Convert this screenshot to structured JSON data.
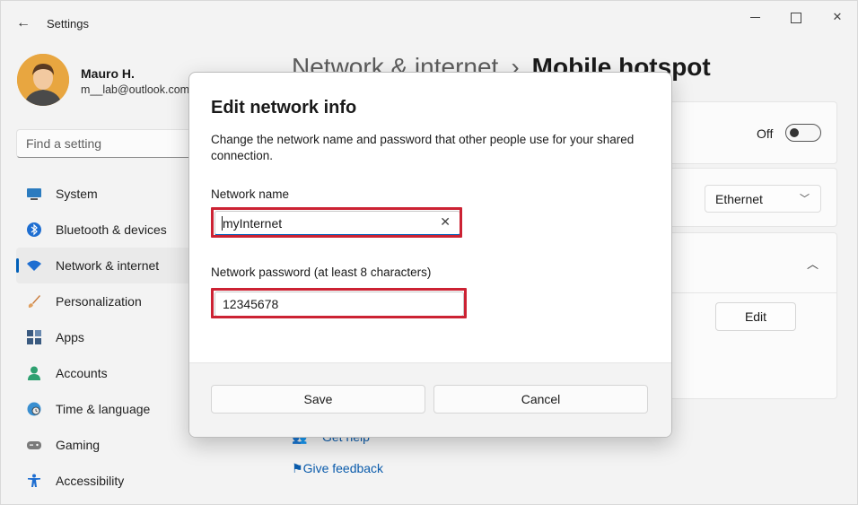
{
  "window": {
    "title": "Settings"
  },
  "user": {
    "name": "Mauro H.",
    "email": "m__lab@outlook.com"
  },
  "search": {
    "placeholder": "Find a setting"
  },
  "nav": {
    "items": [
      {
        "label": "System",
        "icon": "monitor-icon"
      },
      {
        "label": "Bluetooth & devices",
        "icon": "bluetooth-icon"
      },
      {
        "label": "Network & internet",
        "icon": "wifi-icon",
        "active": true
      },
      {
        "label": "Personalization",
        "icon": "brush-icon"
      },
      {
        "label": "Apps",
        "icon": "apps-icon"
      },
      {
        "label": "Accounts",
        "icon": "person-icon"
      },
      {
        "label": "Time & language",
        "icon": "globe-clock-icon"
      },
      {
        "label": "Gaming",
        "icon": "gamepad-icon"
      },
      {
        "label": "Accessibility",
        "icon": "accessibility-icon"
      }
    ]
  },
  "content": {
    "breadcrumb_parent": "Network & internet",
    "breadcrumb_separator": "›",
    "breadcrumb_current": "Mobile hotspot",
    "hotspot_toggle_label": "Off",
    "share_from_value": "Ethernet",
    "edit_button": "Edit",
    "get_help": "Get help",
    "give_feedback": "Give feedback"
  },
  "dialog": {
    "title": "Edit network info",
    "description": "Change the network name and password that other people use for your shared connection.",
    "name_label": "Network name",
    "name_value": "myInternet",
    "password_label": "Network password (at least 8 characters)",
    "password_value": "12345678",
    "save_label": "Save",
    "cancel_label": "Cancel"
  },
  "colors": {
    "accent": "#005fb8",
    "highlight": "#cc2233"
  }
}
